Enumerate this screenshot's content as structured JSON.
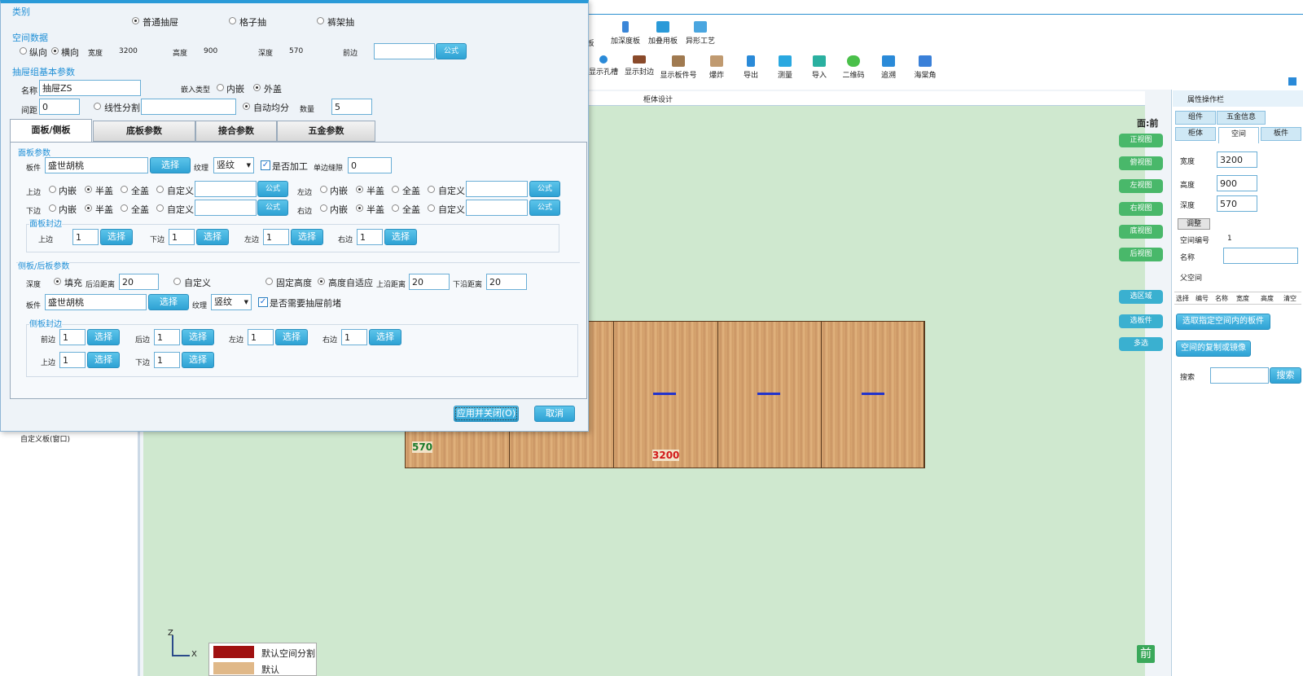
{
  "dialog": {
    "cat_title": "类别",
    "cat_options": [
      "普通抽屉",
      "格子抽",
      "裤架抽"
    ],
    "space_title": "空间数据",
    "dir_v": "纵向",
    "dir_h": "横向",
    "width_label": "宽度",
    "width_val": "3200",
    "height_label": "高度",
    "height_val": "900",
    "depth_label": "深度",
    "depth_val": "570",
    "front_label": "前边",
    "formula": "公式",
    "basic_title": "抽屉组基本参数",
    "name_label": "名称",
    "name_val": "抽屉ZS",
    "embed_label": "嵌入类型",
    "embed_in": "内嵌",
    "embed_out": "外盖",
    "gap_label": "间距",
    "gap_val": "0",
    "line_split": "线性分割",
    "auto_even": "自动均分",
    "count_label": "数量",
    "count_val": "5",
    "tabs": [
      "面板/侧板",
      "底板参数",
      "接合参数",
      "五金参数"
    ],
    "panel_title": "面板参数",
    "board_label": "板件",
    "board_val": "盛世胡桃",
    "select": "选择",
    "grain_label": "纹理",
    "grain_val": "竖纹",
    "process_label": "是否加工",
    "single_gap_label": "单边缝隙",
    "single_gap_val": "0",
    "top_label": "上边",
    "bottom_label": "下边",
    "left_label": "左边",
    "right_label": "右边",
    "opt_in": "内嵌",
    "opt_half": "半盖",
    "opt_full": "全盖",
    "opt_custom": "自定义",
    "edge_title": "面板封边",
    "edge_vals": [
      "1",
      "1",
      "1",
      "1"
    ],
    "side_title": "侧板/后板参数",
    "depth_fill": "填充",
    "back_dist_label": "后沿距离",
    "back_dist_val": "20",
    "custom": "自定义",
    "fixed_h": "固定高度",
    "auto_h": "高度自适应",
    "top_dist_label": "上沿距离",
    "top_dist_val": "20",
    "bot_dist_label": "下沿距离",
    "bot_dist_val": "20",
    "side_board_val": "盛世胡桃",
    "side_grain_val": "竖纹",
    "need_front": "是否需要抽屉前堵",
    "side_edge_title": "侧板封边",
    "back_label": "后边",
    "se_vals": [
      "1",
      "1",
      "1",
      "1",
      "1",
      "1"
    ],
    "apply": "应用并关闭(O)",
    "cancel": "取消"
  },
  "toolbar": {
    "top": [
      "板",
      "加深度板",
      "加叠用板",
      "异形工艺"
    ],
    "bottom": [
      "显示孔槽",
      "显示封边",
      "显示板件号",
      "爆炸",
      "导出",
      "测量",
      "导入",
      "二维码",
      "追溯",
      "海棠角"
    ]
  },
  "canvas": {
    "tab_title": "柜体设计",
    "face": "面:前",
    "views": [
      "正视图",
      "俯视图",
      "左视图",
      "右视图",
      "底视图",
      "后视图"
    ],
    "tools": [
      "选区域",
      "选板件",
      "多选"
    ],
    "dim_depth": "570",
    "dim_width": "3200",
    "legend": [
      "默认空间分割",
      "默认"
    ],
    "front_badge": "前",
    "axis_z": "Z",
    "axis_x": "X"
  },
  "left": {
    "custom_board": "自定义板(窗口)"
  },
  "props": {
    "title": "属性操作栏",
    "tabs1": [
      "组件",
      "五金信息"
    ],
    "tabs2": [
      "柜体",
      "空间",
      "板件"
    ],
    "width_label": "宽度",
    "width_val": "3200",
    "height_label": "高度",
    "height_val": "900",
    "depth_label": "深度",
    "depth_val": "570",
    "adjust": "调整",
    "space_no_label": "空间编号",
    "space_no_val": "1",
    "name_label": "名称",
    "parent_label": "父空间",
    "cols": [
      "选择",
      "编号",
      "名称",
      "宽度",
      "高度",
      "清空"
    ],
    "pick_btn": "选取指定空间内的板件",
    "copy_btn": "空间的复制或镜像",
    "search_label": "搜索",
    "search_btn": "搜索"
  }
}
